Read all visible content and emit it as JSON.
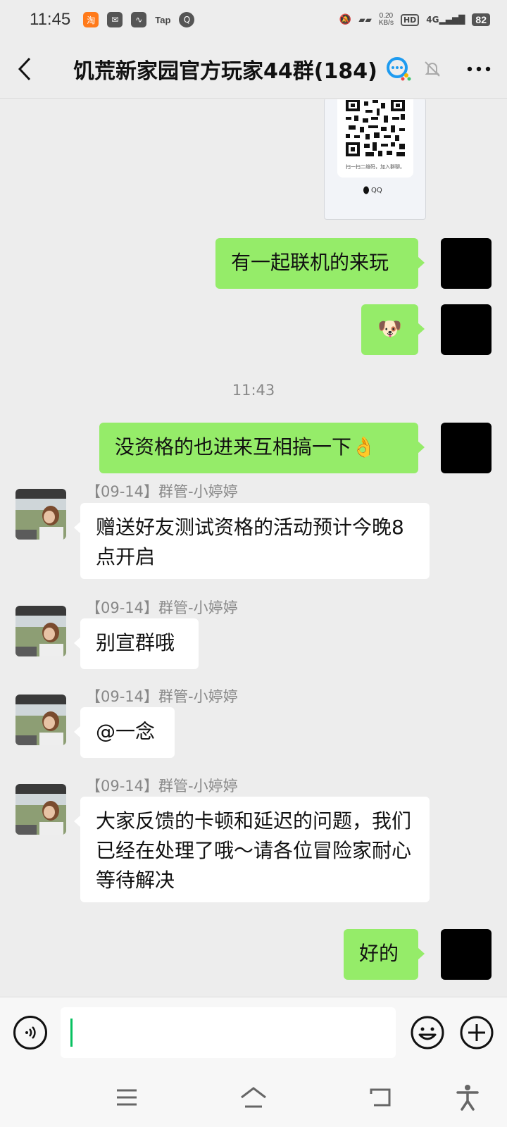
{
  "status_bar": {
    "time": "11:45",
    "app_icons": [
      "taobao-icon",
      "mail-icon",
      "feather-icon",
      "tap-icon",
      "q-icon"
    ],
    "tap_label": "Tap",
    "network_speed_value": "0.20",
    "network_speed_unit": "KB/s",
    "hd_label": "HD",
    "signal_label": "4G",
    "battery": "82"
  },
  "header": {
    "title": "饥荒新家园官方玩家44群(184)"
  },
  "chat": {
    "qr_card": {
      "caption": "扫一扫二维码，加入群聊。",
      "brand": "QQ"
    },
    "messages": [
      {
        "text": "有一起联机的来玩"
      },
      {
        "text": "🐶"
      },
      {
        "text": "没资格的也进来互相搞一下👌"
      },
      {
        "sender": "【09-14】群管-小婷婷",
        "text": "赠送好友测试资格的活动预计今晚8 点开启"
      },
      {
        "sender": "【09-14】群管-小婷婷",
        "text": "别宣群哦"
      },
      {
        "sender": "【09-14】群管-小婷婷",
        "text": "@一念"
      },
      {
        "sender": "【09-14】群管-小婷婷",
        "text": "大家反馈的卡顿和延迟的问题，我们已经在处理了哦～请各位冒险家耐心等待解决"
      },
      {
        "text": "好的"
      }
    ],
    "timestamp": "11:43"
  },
  "input_bar": {
    "value": "",
    "placeholder": ""
  },
  "colors": {
    "my_bubble": "#95ec69",
    "their_bubble": "#ffffff",
    "background": "#ededed",
    "accent": "#07c160"
  }
}
